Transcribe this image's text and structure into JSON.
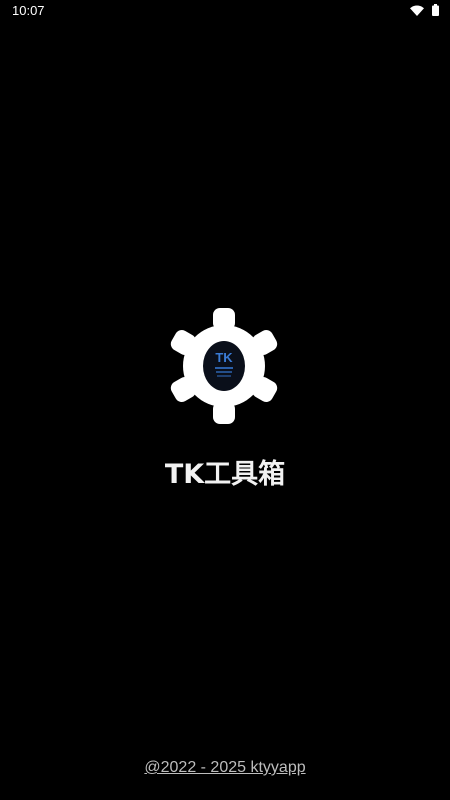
{
  "status_bar": {
    "time": "10:07",
    "icons": [
      "wifi-icon",
      "battery-icon"
    ]
  },
  "splash": {
    "logo_icon": "gear-icon",
    "logo_badge_text": "TK",
    "app_name": "TK工具箱"
  },
  "footer": {
    "copyright": "@2022 - 2025 ktyyapp"
  },
  "colors": {
    "background": "#000000",
    "gear": "#ffffff",
    "badge_bg": "#0a0f1a",
    "badge_text": "#3a7bd5",
    "app_name": "#f2f2f2",
    "copyright": "#bdbdbd"
  }
}
